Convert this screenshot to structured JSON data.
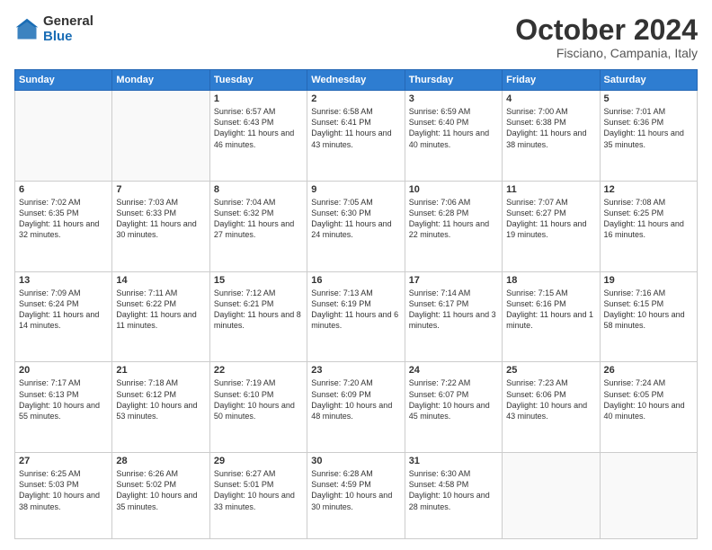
{
  "logo": {
    "general": "General",
    "blue": "Blue"
  },
  "header": {
    "month": "October 2024",
    "location": "Fisciano, Campania, Italy"
  },
  "weekdays": [
    "Sunday",
    "Monday",
    "Tuesday",
    "Wednesday",
    "Thursday",
    "Friday",
    "Saturday"
  ],
  "weeks": [
    [
      {
        "day": "",
        "sunrise": "",
        "sunset": "",
        "daylight": ""
      },
      {
        "day": "",
        "sunrise": "",
        "sunset": "",
        "daylight": ""
      },
      {
        "day": "1",
        "sunrise": "Sunrise: 6:57 AM",
        "sunset": "Sunset: 6:43 PM",
        "daylight": "Daylight: 11 hours and 46 minutes."
      },
      {
        "day": "2",
        "sunrise": "Sunrise: 6:58 AM",
        "sunset": "Sunset: 6:41 PM",
        "daylight": "Daylight: 11 hours and 43 minutes."
      },
      {
        "day": "3",
        "sunrise": "Sunrise: 6:59 AM",
        "sunset": "Sunset: 6:40 PM",
        "daylight": "Daylight: 11 hours and 40 minutes."
      },
      {
        "day": "4",
        "sunrise": "Sunrise: 7:00 AM",
        "sunset": "Sunset: 6:38 PM",
        "daylight": "Daylight: 11 hours and 38 minutes."
      },
      {
        "day": "5",
        "sunrise": "Sunrise: 7:01 AM",
        "sunset": "Sunset: 6:36 PM",
        "daylight": "Daylight: 11 hours and 35 minutes."
      }
    ],
    [
      {
        "day": "6",
        "sunrise": "Sunrise: 7:02 AM",
        "sunset": "Sunset: 6:35 PM",
        "daylight": "Daylight: 11 hours and 32 minutes."
      },
      {
        "day": "7",
        "sunrise": "Sunrise: 7:03 AM",
        "sunset": "Sunset: 6:33 PM",
        "daylight": "Daylight: 11 hours and 30 minutes."
      },
      {
        "day": "8",
        "sunrise": "Sunrise: 7:04 AM",
        "sunset": "Sunset: 6:32 PM",
        "daylight": "Daylight: 11 hours and 27 minutes."
      },
      {
        "day": "9",
        "sunrise": "Sunrise: 7:05 AM",
        "sunset": "Sunset: 6:30 PM",
        "daylight": "Daylight: 11 hours and 24 minutes."
      },
      {
        "day": "10",
        "sunrise": "Sunrise: 7:06 AM",
        "sunset": "Sunset: 6:28 PM",
        "daylight": "Daylight: 11 hours and 22 minutes."
      },
      {
        "day": "11",
        "sunrise": "Sunrise: 7:07 AM",
        "sunset": "Sunset: 6:27 PM",
        "daylight": "Daylight: 11 hours and 19 minutes."
      },
      {
        "day": "12",
        "sunrise": "Sunrise: 7:08 AM",
        "sunset": "Sunset: 6:25 PM",
        "daylight": "Daylight: 11 hours and 16 minutes."
      }
    ],
    [
      {
        "day": "13",
        "sunrise": "Sunrise: 7:09 AM",
        "sunset": "Sunset: 6:24 PM",
        "daylight": "Daylight: 11 hours and 14 minutes."
      },
      {
        "day": "14",
        "sunrise": "Sunrise: 7:11 AM",
        "sunset": "Sunset: 6:22 PM",
        "daylight": "Daylight: 11 hours and 11 minutes."
      },
      {
        "day": "15",
        "sunrise": "Sunrise: 7:12 AM",
        "sunset": "Sunset: 6:21 PM",
        "daylight": "Daylight: 11 hours and 8 minutes."
      },
      {
        "day": "16",
        "sunrise": "Sunrise: 7:13 AM",
        "sunset": "Sunset: 6:19 PM",
        "daylight": "Daylight: 11 hours and 6 minutes."
      },
      {
        "day": "17",
        "sunrise": "Sunrise: 7:14 AM",
        "sunset": "Sunset: 6:17 PM",
        "daylight": "Daylight: 11 hours and 3 minutes."
      },
      {
        "day": "18",
        "sunrise": "Sunrise: 7:15 AM",
        "sunset": "Sunset: 6:16 PM",
        "daylight": "Daylight: 11 hours and 1 minute."
      },
      {
        "day": "19",
        "sunrise": "Sunrise: 7:16 AM",
        "sunset": "Sunset: 6:15 PM",
        "daylight": "Daylight: 10 hours and 58 minutes."
      }
    ],
    [
      {
        "day": "20",
        "sunrise": "Sunrise: 7:17 AM",
        "sunset": "Sunset: 6:13 PM",
        "daylight": "Daylight: 10 hours and 55 minutes."
      },
      {
        "day": "21",
        "sunrise": "Sunrise: 7:18 AM",
        "sunset": "Sunset: 6:12 PM",
        "daylight": "Daylight: 10 hours and 53 minutes."
      },
      {
        "day": "22",
        "sunrise": "Sunrise: 7:19 AM",
        "sunset": "Sunset: 6:10 PM",
        "daylight": "Daylight: 10 hours and 50 minutes."
      },
      {
        "day": "23",
        "sunrise": "Sunrise: 7:20 AM",
        "sunset": "Sunset: 6:09 PM",
        "daylight": "Daylight: 10 hours and 48 minutes."
      },
      {
        "day": "24",
        "sunrise": "Sunrise: 7:22 AM",
        "sunset": "Sunset: 6:07 PM",
        "daylight": "Daylight: 10 hours and 45 minutes."
      },
      {
        "day": "25",
        "sunrise": "Sunrise: 7:23 AM",
        "sunset": "Sunset: 6:06 PM",
        "daylight": "Daylight: 10 hours and 43 minutes."
      },
      {
        "day": "26",
        "sunrise": "Sunrise: 7:24 AM",
        "sunset": "Sunset: 6:05 PM",
        "daylight": "Daylight: 10 hours and 40 minutes."
      }
    ],
    [
      {
        "day": "27",
        "sunrise": "Sunrise: 6:25 AM",
        "sunset": "Sunset: 5:03 PM",
        "daylight": "Daylight: 10 hours and 38 minutes."
      },
      {
        "day": "28",
        "sunrise": "Sunrise: 6:26 AM",
        "sunset": "Sunset: 5:02 PM",
        "daylight": "Daylight: 10 hours and 35 minutes."
      },
      {
        "day": "29",
        "sunrise": "Sunrise: 6:27 AM",
        "sunset": "Sunset: 5:01 PM",
        "daylight": "Daylight: 10 hours and 33 minutes."
      },
      {
        "day": "30",
        "sunrise": "Sunrise: 6:28 AM",
        "sunset": "Sunset: 4:59 PM",
        "daylight": "Daylight: 10 hours and 30 minutes."
      },
      {
        "day": "31",
        "sunrise": "Sunrise: 6:30 AM",
        "sunset": "Sunset: 4:58 PM",
        "daylight": "Daylight: 10 hours and 28 minutes."
      },
      {
        "day": "",
        "sunrise": "",
        "sunset": "",
        "daylight": ""
      },
      {
        "day": "",
        "sunrise": "",
        "sunset": "",
        "daylight": ""
      }
    ]
  ]
}
